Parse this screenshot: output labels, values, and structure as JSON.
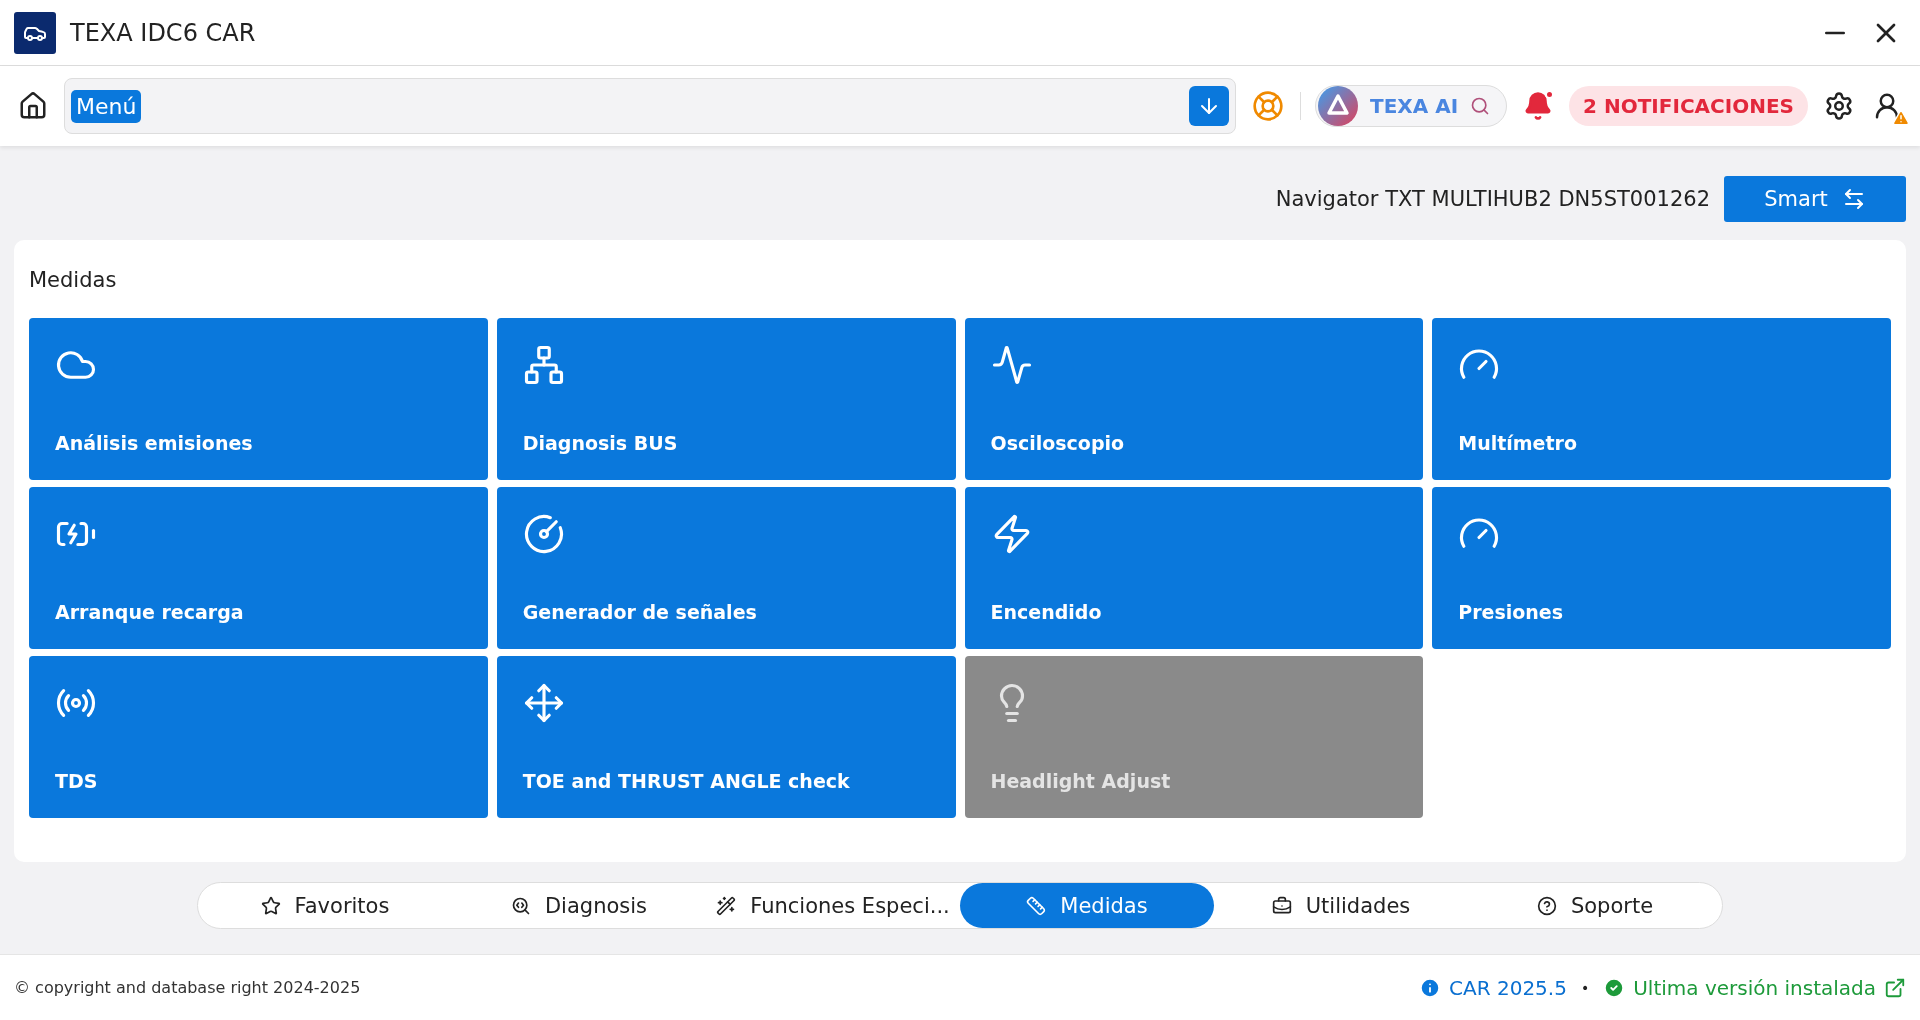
{
  "window": {
    "title": "TEXA IDC6 CAR"
  },
  "toolbar": {
    "menu_value": "Menú",
    "ai_label": "TEXA AI",
    "notifications": "2 NOTIFICACIONES"
  },
  "device": {
    "name": "Navigator TXT MULTIHUB2 DN5ST001262",
    "button": "Smart"
  },
  "section": {
    "title": "Medidas",
    "tiles": [
      {
        "label": "Análisis emisiones",
        "disabled": false
      },
      {
        "label": "Diagnosis BUS",
        "disabled": false
      },
      {
        "label": "Osciloscopio",
        "disabled": false
      },
      {
        "label": "Multímetro",
        "disabled": false
      },
      {
        "label": "Arranque recarga",
        "disabled": false
      },
      {
        "label": "Generador de señales",
        "disabled": false
      },
      {
        "label": "Encendido",
        "disabled": false
      },
      {
        "label": "Presiones",
        "disabled": false
      },
      {
        "label": "TDS",
        "disabled": false
      },
      {
        "label": "TOE and THRUST ANGLE check",
        "disabled": false
      },
      {
        "label": "Headlight Adjust",
        "disabled": true
      }
    ]
  },
  "tabs": [
    {
      "label": "Favoritos",
      "selected": false
    },
    {
      "label": "Diagnosis",
      "selected": false
    },
    {
      "label": "Funciones Especi...",
      "selected": false
    },
    {
      "label": "Medidas",
      "selected": true
    },
    {
      "label": "Utilidades",
      "selected": false
    },
    {
      "label": "Soporte",
      "selected": false
    }
  ],
  "status_bar": {
    "copyright": "© copyright and database right 2024-2025",
    "version": "CAR 2025.5",
    "separator": "•",
    "update_status": "Ultima versión instalada"
  }
}
